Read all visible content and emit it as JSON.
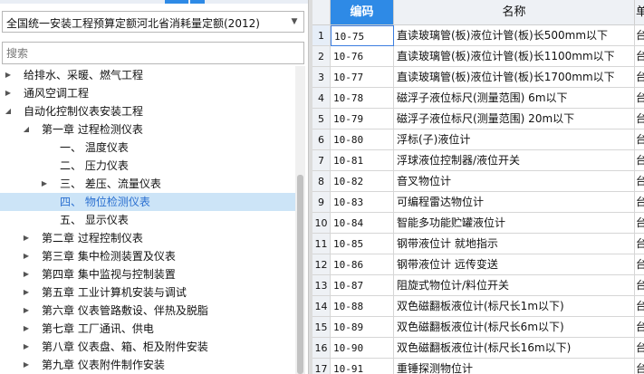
{
  "library": {
    "selected": "全国统一安装工程预算定额河北省消耗量定额(2012)"
  },
  "search": {
    "placeholder": "搜索"
  },
  "tree": [
    {
      "label": "给排水、采暖、燃气工程",
      "level": 0,
      "state": "collapsed"
    },
    {
      "label": "通风空调工程",
      "level": 0,
      "state": "collapsed"
    },
    {
      "label": "自动化控制仪表安装工程",
      "level": 0,
      "state": "expanded"
    },
    {
      "label": "第一章 过程检测仪表",
      "level": 1,
      "state": "expanded"
    },
    {
      "label": "一、  温度仪表",
      "level": 2,
      "state": "leaf"
    },
    {
      "label": "二、  压力仪表",
      "level": 2,
      "state": "leaf"
    },
    {
      "label": "三、  差压、流量仪表",
      "level": 2,
      "state": "collapsed"
    },
    {
      "label": "四、  物位检测仪表",
      "level": 2,
      "state": "leaf",
      "selected": true
    },
    {
      "label": "五、  显示仪表",
      "level": 2,
      "state": "leaf"
    },
    {
      "label": "第二章 过程控制仪表",
      "level": 1,
      "state": "collapsed"
    },
    {
      "label": "第三章 集中检测装置及仪表",
      "level": 1,
      "state": "collapsed"
    },
    {
      "label": "第四章 集中监视与控制装置",
      "level": 1,
      "state": "collapsed"
    },
    {
      "label": "第五章 工业计算机安装与调试",
      "level": 1,
      "state": "collapsed"
    },
    {
      "label": "第六章 仪表管路敷设、伴热及脱脂",
      "level": 1,
      "state": "collapsed"
    },
    {
      "label": "第七章 工厂通讯、供电",
      "level": 1,
      "state": "collapsed"
    },
    {
      "label": "第八章 仪表盘、箱、柜及附件安装",
      "level": 1,
      "state": "collapsed"
    },
    {
      "label": "第九章 仪表附件制作安装",
      "level": 1,
      "state": "collapsed"
    }
  ],
  "grid": {
    "columns": {
      "code": "编码",
      "name": "名称",
      "unit": "单"
    },
    "rows": [
      {
        "n": "1",
        "code": "10-75",
        "name": "直读玻璃管(板)液位计管(板)长500mm以下",
        "unit": "台"
      },
      {
        "n": "2",
        "code": "10-76",
        "name": "直读玻璃管(板)液位计管(板)长1100mm以下",
        "unit": "台"
      },
      {
        "n": "3",
        "code": "10-77",
        "name": "直读玻璃管(板)液位计管(板)长1700mm以下",
        "unit": "台"
      },
      {
        "n": "4",
        "code": "10-78",
        "name": "磁浮子液位标尺(测量范围) 6m以下",
        "unit": "台"
      },
      {
        "n": "5",
        "code": "10-79",
        "name": "磁浮子液位标尺(测量范围) 20m以下",
        "unit": "台"
      },
      {
        "n": "6",
        "code": "10-80",
        "name": "浮标(子)液位计",
        "unit": "台"
      },
      {
        "n": "7",
        "code": "10-81",
        "name": "浮球液位控制器/液位开关",
        "unit": "台"
      },
      {
        "n": "8",
        "code": "10-82",
        "name": "音叉物位计",
        "unit": "台"
      },
      {
        "n": "9",
        "code": "10-83",
        "name": "可编程雷达物位计",
        "unit": "台"
      },
      {
        "n": "10",
        "code": "10-84",
        "name": "智能多功能贮罐液位计",
        "unit": "台"
      },
      {
        "n": "11",
        "code": "10-85",
        "name": "钢带液位计 就地指示",
        "unit": "台"
      },
      {
        "n": "12",
        "code": "10-86",
        "name": "钢带液位计 远传变送",
        "unit": "台"
      },
      {
        "n": "13",
        "code": "10-87",
        "name": "阻旋式物位计/料位开关",
        "unit": "台"
      },
      {
        "n": "14",
        "code": "10-88",
        "name": "双色磁翻板液位计(标尺长1m以下)",
        "unit": "台"
      },
      {
        "n": "15",
        "code": "10-89",
        "name": "双色磁翻板液位计(标尺长6m以下)",
        "unit": "台"
      },
      {
        "n": "16",
        "code": "10-90",
        "name": "双色磁翻板液位计(标尺长16m以下)",
        "unit": "台"
      },
      {
        "n": "17",
        "code": "10-91",
        "name": "重锤探测物位计",
        "unit": "台"
      }
    ]
  }
}
